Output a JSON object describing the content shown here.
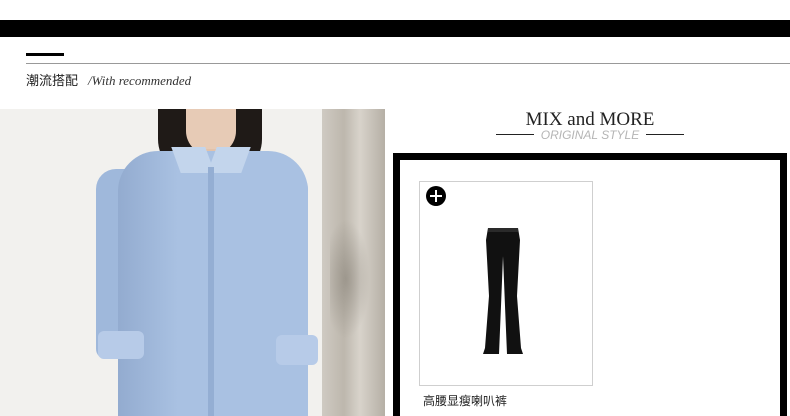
{
  "section": {
    "title_cn": "潮流搭配",
    "title_en": "/With recommended"
  },
  "photo": {
    "subject": "model in light blue shirt dress"
  },
  "feature": {
    "title": "MIX and MORE",
    "subtitle": "ORIGINAL STYLE"
  },
  "products": [
    {
      "name": "高腰显瘦喇叭裤",
      "icon": "plus-circle-icon"
    }
  ],
  "colors": {
    "bar": "#000000",
    "shirt": "#a9c1e2",
    "subtitle": "#b5b5b5"
  }
}
